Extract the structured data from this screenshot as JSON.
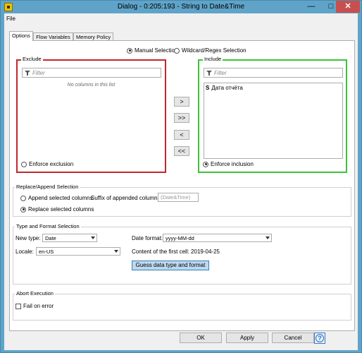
{
  "window": {
    "title": "Dialog - 0:205:193 - String to Date&Time",
    "minimize": "—",
    "maximize": "□",
    "close": "✕"
  },
  "menu": {
    "file": "File"
  },
  "tabs": [
    {
      "label": "Options",
      "active": true
    },
    {
      "label": "Flow Variables",
      "active": false
    },
    {
      "label": "Memory Policy",
      "active": false
    }
  ],
  "selection_mode": {
    "manual": "Manual Selection",
    "wildcard": "Wildcard/Regex Selection",
    "selected": "manual"
  },
  "exclude": {
    "title": "Exclude",
    "filter_placeholder": "Filter",
    "empty_text": "No columns in this list",
    "enforce": "Enforce exclusion",
    "border_color": "#c0282a"
  },
  "include": {
    "title": "Include",
    "filter_placeholder": "Filter",
    "items": [
      {
        "type": "S",
        "label": "Дата отчёта"
      }
    ],
    "enforce": "Enforce inclusion",
    "border_color": "#3cc23a"
  },
  "move_buttons": {
    "add": ">",
    "add_all": ">>",
    "remove": "<",
    "remove_all": "<<"
  },
  "replace_append": {
    "title": "Replace/Append Selection",
    "append": "Append selected columns",
    "replace": "Replace selected columns",
    "selected": "replace",
    "suffix_label": "Suffix of appended columns:",
    "suffix_value": "(Date&Time)"
  },
  "type_format": {
    "title": "Type and Format Selection",
    "new_type_label": "New type:",
    "new_type_value": "Date",
    "date_format_label": "Date format:",
    "date_format_value": "yyyy-MM-dd",
    "locale_label": "Locale:",
    "locale_value": "en-US",
    "content_first_cell": "Content of the first cell: 2019-04-25",
    "guess_button": "Guess data type and format"
  },
  "abort": {
    "title": "Abort Execution",
    "fail_on_error": "Fail on error"
  },
  "footer": {
    "ok": "OK",
    "apply": "Apply",
    "cancel": "Cancel",
    "help": "?"
  },
  "colors": {
    "titlebar": "#5fa4c8",
    "close": "#c7504f",
    "guess_button": "#bcd8ef"
  }
}
